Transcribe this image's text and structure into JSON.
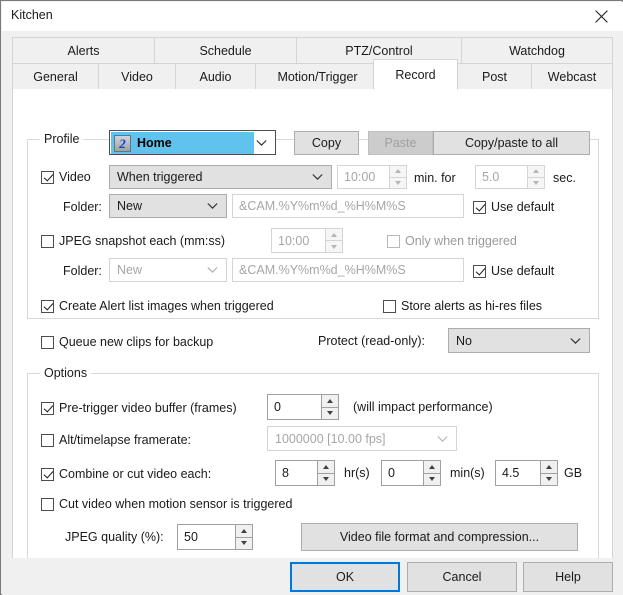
{
  "window": {
    "title": "Kitchen",
    "close_icon": "close-icon"
  },
  "tabs": {
    "row1": [
      {
        "label": "Alerts"
      },
      {
        "label": "Schedule"
      },
      {
        "label": "PTZ/Control"
      },
      {
        "label": "Watchdog"
      }
    ],
    "row2": [
      {
        "label": "General"
      },
      {
        "label": "Video"
      },
      {
        "label": "Audio"
      },
      {
        "label": "Motion/Trigger"
      },
      {
        "label": "Record"
      },
      {
        "label": "Post"
      },
      {
        "label": "Webcast"
      }
    ],
    "selected": "Record"
  },
  "profile_group": {
    "legend": "Profile",
    "combo": {
      "icon_text": "2",
      "value": "Home"
    },
    "copy_button": "Copy",
    "paste_button": "Paste",
    "copy_paste_all_button": "Copy/paste to all",
    "video": {
      "checkbox_label": "Video",
      "checked": true,
      "mode": "When triggered",
      "duration_value": "10:00",
      "duration_unit": "min. for",
      "post_value": "5.0",
      "post_unit": "sec.",
      "folder_label": "Folder:",
      "folder_mode": "New",
      "folder_pattern": "&CAM.%Y%m%d_%H%M%S",
      "use_default_label": "Use default",
      "use_default_checked": true
    },
    "jpeg": {
      "checkbox_label": "JPEG snapshot each (mm:ss)",
      "checked": false,
      "interval_value": "10:00",
      "only_when_triggered_label": "Only when triggered",
      "only_when_triggered_checked": false,
      "folder_label": "Folder:",
      "folder_mode": "New",
      "folder_pattern": "&CAM.%Y%m%d_%H%M%S",
      "use_default_label": "Use default",
      "use_default_checked": true
    },
    "create_alert_images": {
      "label": "Create Alert list images when triggered",
      "checked": true
    },
    "store_hires": {
      "label": "Store alerts as hi-res files",
      "checked": false
    },
    "queue_backup": {
      "label": "Queue new clips for backup",
      "checked": false
    },
    "protect": {
      "label": "Protect (read-only):",
      "value": "No"
    }
  },
  "options_group": {
    "legend": "Options",
    "pretrigger": {
      "label": "Pre-trigger video buffer (frames)",
      "checked": true,
      "value": "0",
      "hint": "(will impact performance)"
    },
    "alt_framerate": {
      "label": "Alt/timelapse framerate:",
      "checked": false,
      "value": "1000000 [10.00 fps]"
    },
    "combine_cut": {
      "label": "Combine or cut video each:",
      "checked": true,
      "hours_value": "8",
      "hours_unit": "hr(s)",
      "minutes_value": "0",
      "minutes_unit": "min(s)",
      "size_value": "4.5",
      "size_unit": "GB"
    },
    "cut_on_motion": {
      "label": "Cut video when motion sensor is triggered",
      "checked": false
    },
    "jpeg_quality": {
      "label": "JPEG quality (%):",
      "value": "50"
    },
    "video_format_button": "Video file format and compression..."
  },
  "footer": {
    "ok": "OK",
    "cancel": "Cancel",
    "help": "Help"
  }
}
